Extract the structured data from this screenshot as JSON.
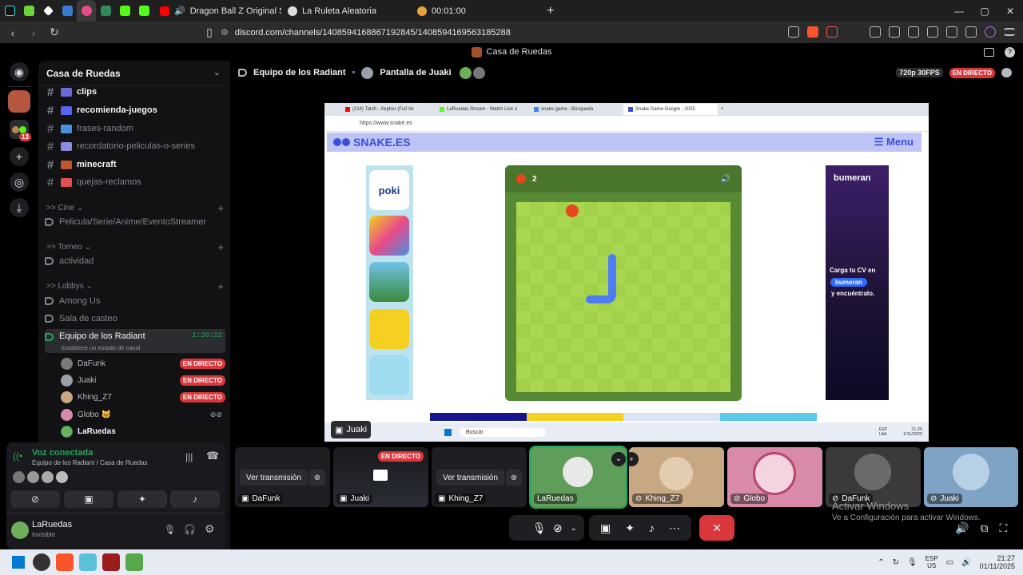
{
  "browser": {
    "tabs": [
      {
        "title": "Dragon Ball Z Original Soundtrac",
        "icon": "youtube-icon"
      },
      {
        "title": "La Ruleta Aleatoria",
        "icon": "page-icon"
      },
      {
        "title": "00:01:00",
        "icon": "timer-icon"
      }
    ],
    "new_tab": "+",
    "url": "discord.com/channels/1408594168867192845/1408594169563185288",
    "window_controls": [
      "—",
      "▢",
      "✕"
    ]
  },
  "discord": {
    "window_title": "Casa de Ruedas",
    "rail_badge": "13",
    "server_name": "Casa de Ruedas",
    "text_channels": [
      {
        "name": "clips",
        "bold": true,
        "emoji_color": "#6b6bd8"
      },
      {
        "name": "recomienda-juegos",
        "bold": true,
        "emoji_color": "#5865f2"
      },
      {
        "name": "frases-random",
        "bold": false,
        "emoji_color": "#4a90e2"
      },
      {
        "name": "recordatorio-peliculas-o-series",
        "bold": false,
        "emoji_color": "#8c8ce0"
      },
      {
        "name": "minecraft",
        "bold": true,
        "emoji_color": "#c0562b"
      },
      {
        "name": "quejas-reclamos",
        "bold": false,
        "emoji_color": "#e05050"
      }
    ],
    "categories": {
      "cine": ">> Cine",
      "cine_channel": "Pelicula/Serie/Anime/EventoStreamer",
      "torneo": ">> Torneo",
      "torneo_channel": "actividad",
      "lobbys": ">> Lobbys",
      "lobby_channels": [
        "Among Us",
        "Sala de casteo"
      ]
    },
    "active_voice": {
      "name": "Equipo de los Radiant",
      "timer": "1:36:22",
      "status": "Establece un estado de canal"
    },
    "voice_members": [
      {
        "name": "DaFunk",
        "live": "EN DIRECTO",
        "color": "#7a7a7a"
      },
      {
        "name": "Juaki",
        "live": "EN DIRECTO",
        "color": "#9aa0aa"
      },
      {
        "name": "Khing_Z7",
        "live": "EN DIRECTO",
        "color": "#c8a882"
      },
      {
        "name": "Globo 🐱",
        "live": "",
        "color": "#d98aa8"
      },
      {
        "name": "LaRuedas",
        "live": "",
        "color": "#6fae5a"
      }
    ],
    "voice_panel": {
      "title": "Voz conectada",
      "subtitle": "Equipo de los Radiant / Casa de Ruedas"
    },
    "user": {
      "name": "LaRuedas",
      "status": "Invisible"
    }
  },
  "header": {
    "channel": "Equipo de los Radiant",
    "screen": "Pantalla de Juaki",
    "quality": "720p 30FPS",
    "live": "EN DIRECTO"
  },
  "stream": {
    "inner_tabs": [
      "(214) Tatsh - Xepher (Full Ve",
      "LaRuedas Stream - Watch Live o",
      "snake game - Búsqueda",
      "Snake Game Google - 2025"
    ],
    "inner_url": "https://www.snake.es",
    "site_name": "SNAKE.ES",
    "menu": "☰ Menu",
    "score": "2",
    "ad_brand": "bumeran",
    "ad_text_1": "Carga tu CV en",
    "ad_text_2": "bumeran",
    "ad_text_3": "y encuéntralo.",
    "taskbar_search": "Buscar",
    "taskbar_lang": "ESP LAA",
    "taskbar_time": "21:26",
    "taskbar_date": "1/11/2025",
    "streamer_label": "Juaki"
  },
  "tiles": [
    {
      "name": "DaFunk",
      "watch": "Ver transmisión",
      "type": "watch"
    },
    {
      "name": "Juaki",
      "live": "EN DIRECTO",
      "type": "live"
    },
    {
      "name": "Khing_Z7",
      "watch": "Ver transmisión",
      "type": "watch"
    },
    {
      "name": "LaRuedas",
      "type": "cam"
    },
    {
      "name": "Khing_Z7",
      "type": "cam"
    },
    {
      "name": "Globo",
      "type": "cam"
    },
    {
      "name": "DaFunk",
      "type": "cam"
    },
    {
      "name": "Juaki",
      "type": "cam"
    }
  ],
  "activate_windows": {
    "title": "Activar Windows",
    "subtitle": "Ve a Configuración para activar Windows."
  },
  "system_tray": {
    "lang_1": "ESP",
    "lang_2": "US",
    "time": "21:27",
    "date": "01/11/2025"
  }
}
